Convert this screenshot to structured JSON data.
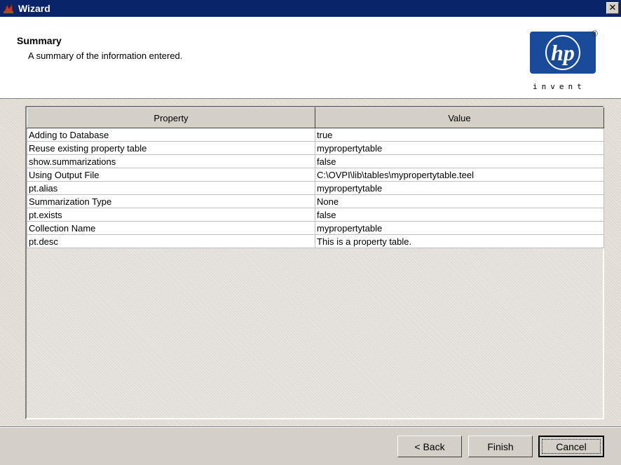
{
  "window": {
    "title": "Wizard",
    "close_glyph": "✕"
  },
  "header": {
    "title": "Summary",
    "subtitle": "A summary of the information entered.",
    "logo": {
      "mark": "hp",
      "registered": "®",
      "tagline": "invent"
    }
  },
  "table": {
    "columns": [
      "Property",
      "Value"
    ],
    "rows": [
      [
        "Adding to Database",
        "true"
      ],
      [
        "Reuse existing property table",
        "mypropertytable"
      ],
      [
        "show.summarizations",
        "false"
      ],
      [
        "Using Output File",
        "C:\\OVPI\\lib\\tables\\mypropertytable.teel"
      ],
      [
        "pt.alias",
        "mypropertytable"
      ],
      [
        "Summarization Type",
        "None"
      ],
      [
        "pt.exists",
        "false"
      ],
      [
        "Collection Name",
        "mypropertytable"
      ],
      [
        "pt.desc",
        "This is a property table."
      ]
    ]
  },
  "buttons": {
    "back": "< Back",
    "finish": "Finish",
    "cancel": "Cancel"
  },
  "colors": {
    "titlebar": "#0a246a",
    "hp_logo_blue": "#1a4a9a",
    "window_bg": "#d4d0c8"
  }
}
